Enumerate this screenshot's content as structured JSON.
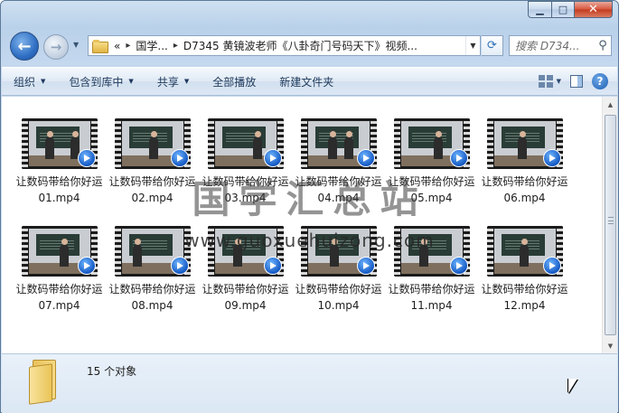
{
  "window": {
    "caption": {
      "minimize_glyph": "▁",
      "maximize_glyph": "□",
      "close_glyph": "✕"
    }
  },
  "address_bar": {
    "overflow": "«",
    "crumbs": [
      "国学...",
      "D7345 黄镜波老师《八卦奇门号码天下》视频..."
    ],
    "folder_icon": "folder-icon"
  },
  "search": {
    "placeholder": "搜索 D734..."
  },
  "toolbar": {
    "organize": "组织",
    "include_in_library": "包含到库中",
    "share": "共享",
    "play_all": "全部播放",
    "new_folder": "新建文件夹"
  },
  "files": [
    {
      "name": "让数码带给你好运01.mp4",
      "icon": "windows-media-player-icon"
    },
    {
      "name": "让数码带给你好运02.mp4",
      "icon": "windows-media-player-icon"
    },
    {
      "name": "让数码带给你好运03.mp4",
      "icon": "windows-media-player-icon"
    },
    {
      "name": "让数码带给你好运04.mp4",
      "icon": "windows-media-player-icon"
    },
    {
      "name": "让数码带给你好运05.mp4",
      "icon": "windows-media-player-icon"
    },
    {
      "name": "让数码带给你好运06.mp4",
      "icon": "windows-media-player-icon"
    },
    {
      "name": "让数码带给你好运07.mp4",
      "icon": "windows-media-player-icon"
    },
    {
      "name": "让数码带给你好运08.mp4",
      "icon": "windows-media-player-icon"
    },
    {
      "name": "让数码带给你好运09.mp4",
      "icon": "windows-media-player-icon"
    },
    {
      "name": "让数码带给你好运10.mp4",
      "icon": "windows-media-player-icon"
    },
    {
      "name": "让数码带给你好运11.mp4",
      "icon": "windows-media-player-icon"
    },
    {
      "name": "让数码带给你好运12.mp4",
      "icon": "windows-media-player-icon"
    }
  ],
  "watermark": {
    "title": "国学汇总站",
    "url": "www.guoxuehuizong.com"
  },
  "details": {
    "object_count": "15 个对象"
  },
  "colors": {
    "frame_top": "#cfe0f1",
    "toolbar": "#dfe9f5",
    "details": "#e9f1fa",
    "close": "#c33b1f"
  }
}
